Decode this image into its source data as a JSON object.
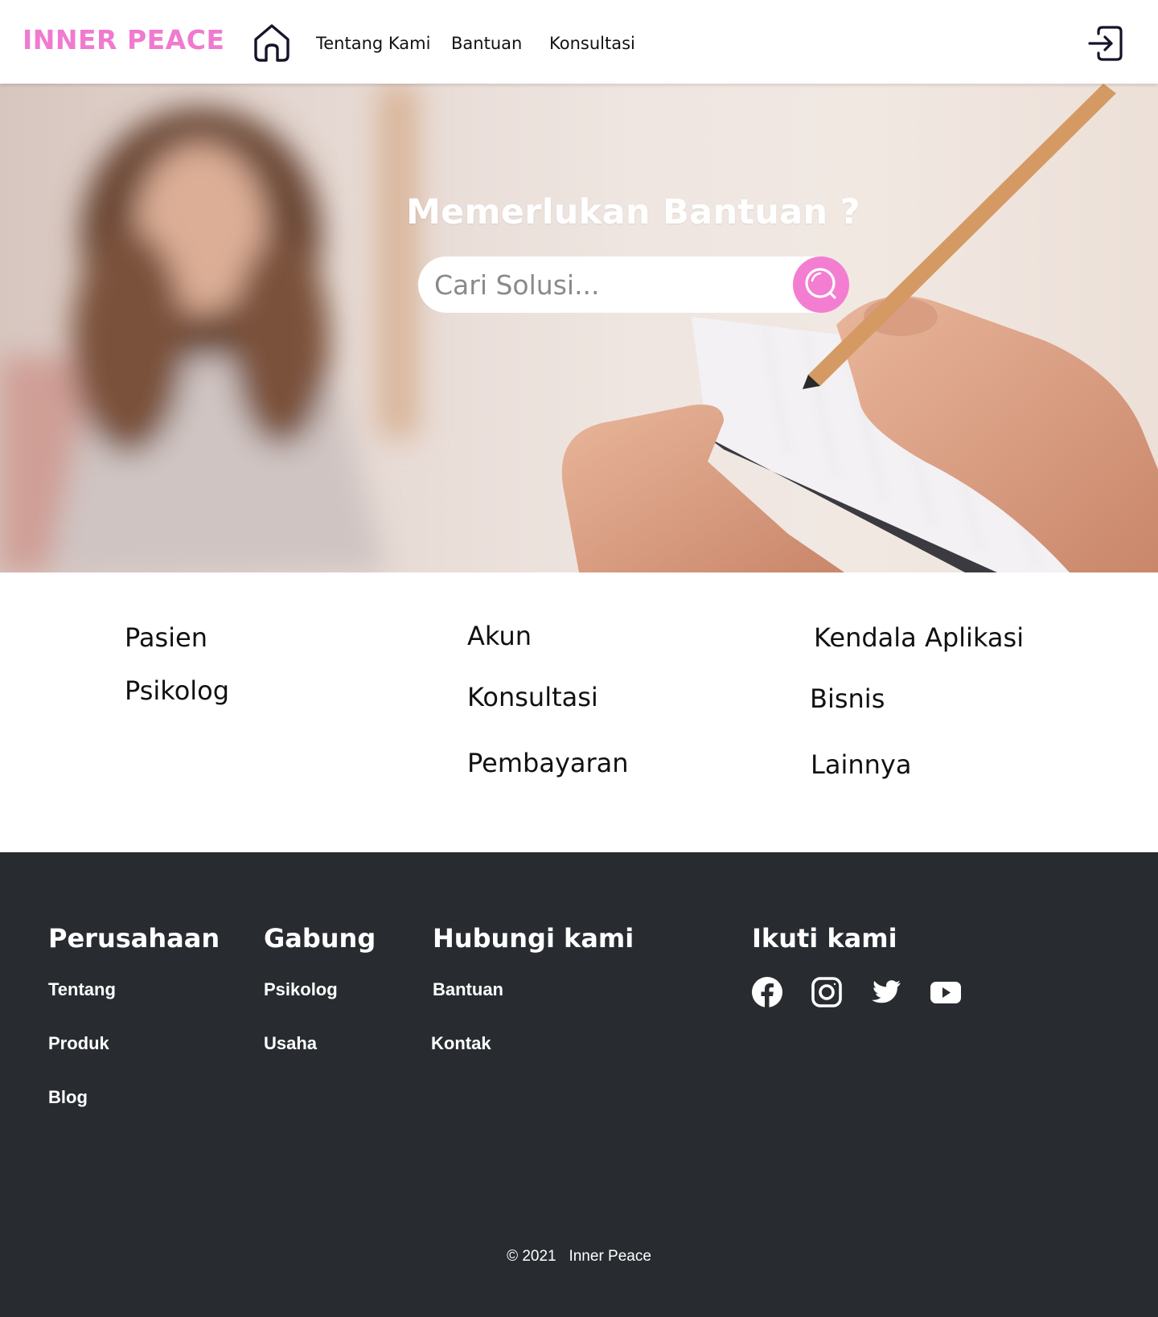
{
  "brand": {
    "name": "INNER PEACE",
    "color": "#f07ad0"
  },
  "nav": {
    "items": [
      {
        "label": "Tentang Kami"
      },
      {
        "label": "Bantuan"
      },
      {
        "label": "Konsultasi"
      }
    ],
    "home_icon": "home-icon",
    "login_icon": "login-icon"
  },
  "hero": {
    "title": "Memerlukan Bantuan ?",
    "search_placeholder": "Cari Solusi...",
    "search_icon": "search-icon",
    "accent": "#f37ed1"
  },
  "categories": {
    "col1": [
      "Pasien",
      "Psikolog"
    ],
    "col2": [
      "Akun",
      "Konsultasi",
      "Pembayaran"
    ],
    "col3": [
      "Kendala Aplikasi",
      "Bisnis",
      "Lainnya"
    ]
  },
  "footer": {
    "background": "#282c31",
    "columns": [
      {
        "heading": "Perusahaan",
        "links": [
          "Tentang",
          "Produk",
          "Blog"
        ]
      },
      {
        "heading": "Gabung",
        "links": [
          "Psikolog",
          "Usaha"
        ]
      },
      {
        "heading": "Hubungi kami",
        "links": [
          "Bantuan",
          "Kontak"
        ]
      }
    ],
    "follow": {
      "heading": "Ikuti kami",
      "icons": [
        "facebook-icon",
        "instagram-icon",
        "twitter-icon",
        "youtube-icon"
      ]
    },
    "copyright": "© 2021   Inner Peace"
  }
}
